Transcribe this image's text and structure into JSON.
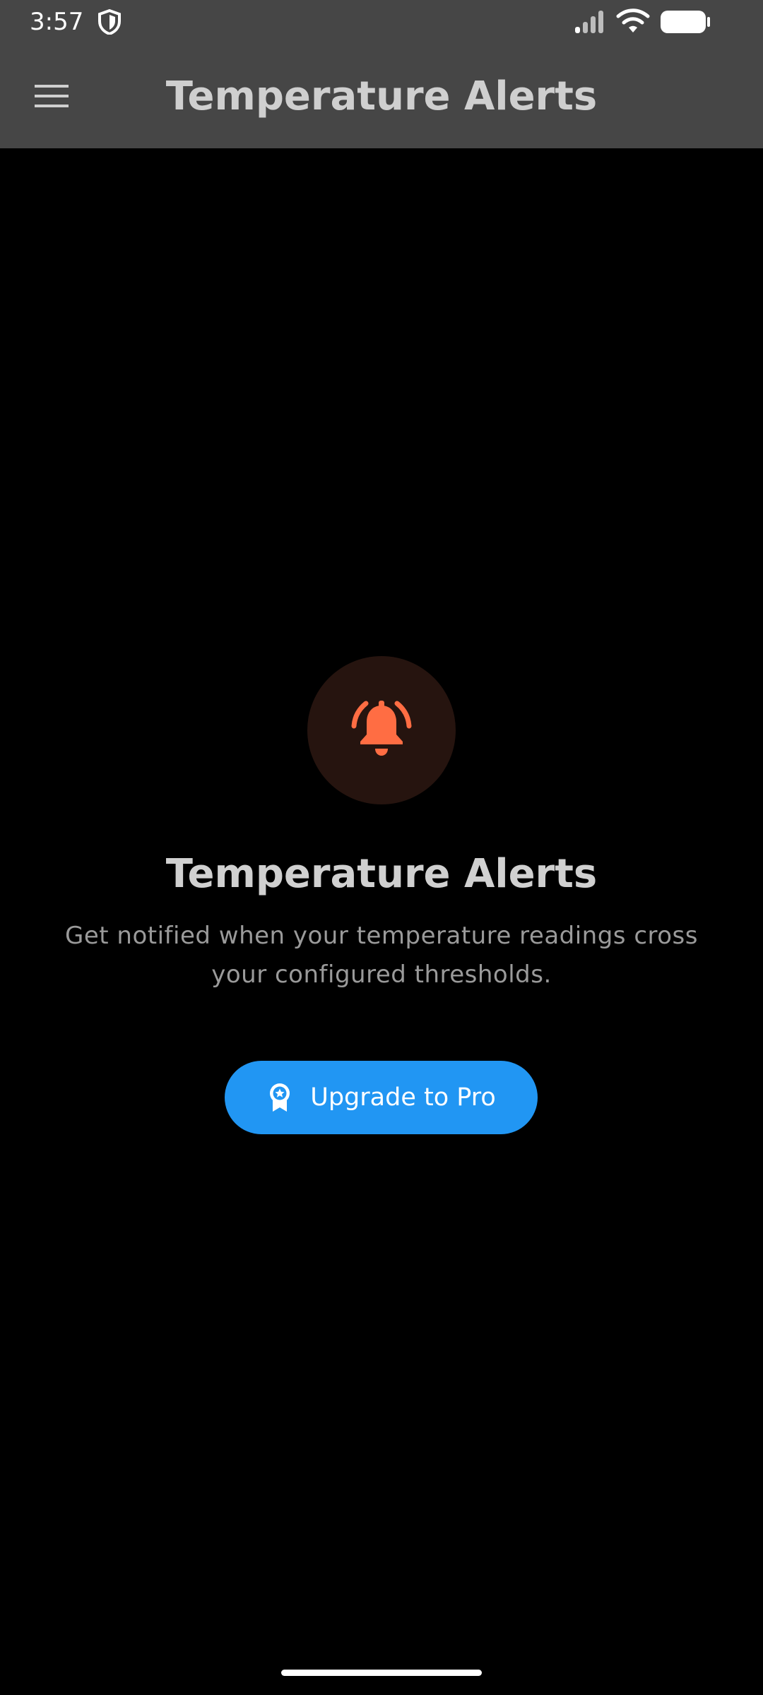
{
  "status_bar": {
    "time": "3:57",
    "icons": [
      "shield-icon",
      "cellular-signal-icon",
      "wifi-icon",
      "battery-icon"
    ]
  },
  "app_bar": {
    "title": "Temperature Alerts",
    "menu_icon": "hamburger-menu-icon"
  },
  "empty_state": {
    "icon": "bell-ringing-icon",
    "title": "Temperature Alerts",
    "description": "Get notified when your temperature readings cross your configured thresholds."
  },
  "upgrade_button": {
    "icon": "award-badge-icon",
    "label": "Upgrade to Pro"
  },
  "colors": {
    "app_bar_bg": "#464646",
    "background": "#000000",
    "accent_orange": "#ff6d43",
    "icon_circle_bg": "#26140f",
    "button_blue": "#2196f3",
    "title_text": "#cfcfcf",
    "body_text": "#9a9a9a"
  }
}
